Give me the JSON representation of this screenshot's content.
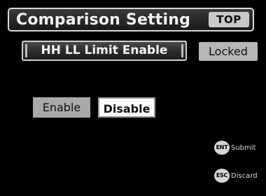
{
  "header": {
    "title": "Comparison Setting",
    "top_button": "TOP"
  },
  "setting": {
    "label": "HH LL Limit Enable",
    "status": "Locked"
  },
  "options": {
    "enable": "Enable",
    "disable": "Disable",
    "selected": "Disable"
  },
  "hints": {
    "submit_key": "ENT",
    "submit_label": "Submit",
    "discard_key": "ESC",
    "discard_label": "Discard"
  },
  "colors": {
    "background": "#000000",
    "selected_option": "#ffffff",
    "unselected_option": "#a9a9a9"
  }
}
